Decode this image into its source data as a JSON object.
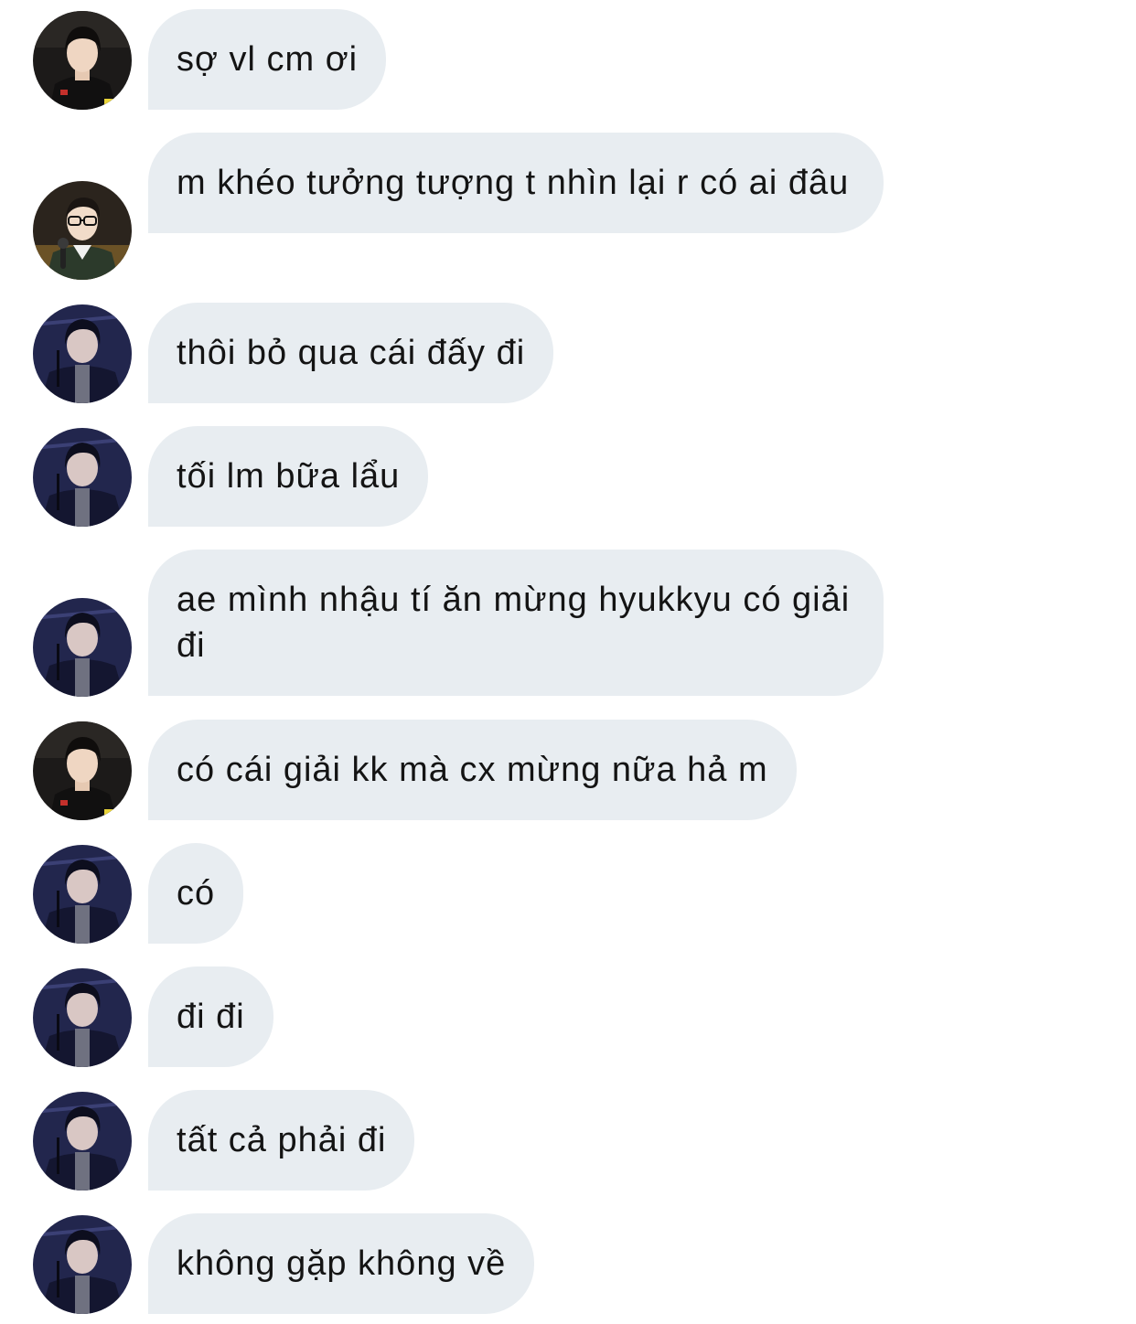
{
  "avatar_icons": {
    "a": "avatar-person-dark-jacket",
    "b": "avatar-person-glasses-microphone",
    "c": "avatar-person-scarf-stage"
  },
  "colors": {
    "bubble": "#e8edf1",
    "text": "#141414",
    "background": "#ffffff"
  },
  "messages": [
    {
      "text": "sợ vl cm ơi"
    },
    {
      "text": "m khéo tưởng tượng t nhìn lại r có ai đâu"
    },
    {
      "text": "thôi bỏ qua cái đấy đi"
    },
    {
      "text": "tối lm bữa lẩu"
    },
    {
      "text": "ae mình nhậu tí ăn mừng hyukkyu có giải đi"
    },
    {
      "text": "có cái giải kk mà cx mừng nữa hả m"
    },
    {
      "text": "có"
    },
    {
      "text": "đi đi"
    },
    {
      "text": "tất cả phải đi"
    },
    {
      "text": "không gặp không về"
    }
  ]
}
